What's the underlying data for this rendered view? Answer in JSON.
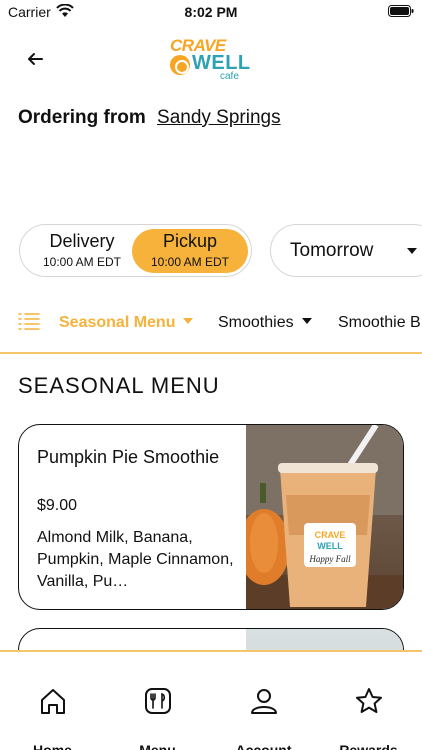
{
  "status_bar": {
    "carrier": "Carrier",
    "time": "8:02 PM"
  },
  "header": {
    "logo": {
      "line1": "CRAVE",
      "line2": "WELL",
      "line3": "cafe"
    },
    "ordering_label": "Ordering from",
    "location": "Sandy Springs"
  },
  "order_mode": {
    "delivery": {
      "label": "Delivery",
      "time": "10:00 AM EDT"
    },
    "pickup": {
      "label": "Pickup",
      "time": "10:00 AM EDT",
      "selected": true
    }
  },
  "day_select": {
    "value": "Tomorrow"
  },
  "categories": [
    {
      "label": "Seasonal Menu",
      "active": true
    },
    {
      "label": "Smoothies",
      "active": false
    },
    {
      "label": "Smoothie B",
      "active": false
    }
  ],
  "section": {
    "title": "Seasonal Menu"
  },
  "products": [
    {
      "name": "Pumpkin Pie Smoothie",
      "price": "$9.00",
      "description": "Almond Milk, Banana, Pumpkin, Maple Cinnamon, Vanilla, Pu…",
      "cup_text": "Happy Fall"
    }
  ],
  "tabs": [
    {
      "label": "Home",
      "icon": "home-icon"
    },
    {
      "label": "Menu",
      "icon": "menu-icon"
    },
    {
      "label": "Account",
      "icon": "account-icon"
    },
    {
      "label": "Rewards",
      "icon": "star-icon"
    }
  ],
  "colors": {
    "accent": "#f6b23a",
    "brand_teal": "#2ea2b3",
    "text": "#111111"
  }
}
